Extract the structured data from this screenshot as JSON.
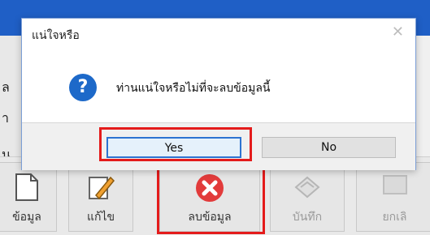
{
  "dialog": {
    "title": "แน่ใจหรือ",
    "message": "ท่านแน่ใจหรือไม่ที่จะลบข้อมูลนี้",
    "yes_label": "Yes",
    "no_label": "No",
    "close_glyph": "✕",
    "question_glyph": "?"
  },
  "toolbar": {
    "buttons": [
      {
        "label": "ข้อมูล",
        "icon": "document-icon"
      },
      {
        "label": "แก้ไข",
        "icon": "edit-pencil-icon"
      },
      {
        "label": "ลบข้อมูล",
        "icon": "delete-x-icon"
      },
      {
        "label": "บันทึก",
        "icon": "save-icon"
      },
      {
        "label": "ยกเลิ",
        "icon": "cancel-icon"
      }
    ]
  },
  "side_labels": [
    "ล",
    "า",
    "น"
  ],
  "colors": {
    "title_bar": "#1f5fc6",
    "highlight": "#e41b1b",
    "question_icon": "#1d69c9",
    "delete_icon": "#e23b3b"
  }
}
